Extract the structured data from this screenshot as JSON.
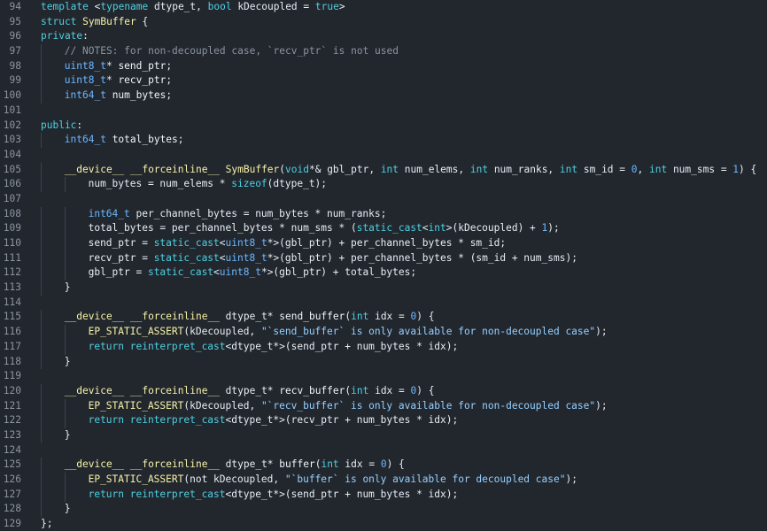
{
  "editor": {
    "colors": {
      "background": "#22272e",
      "line_number": "#8b949e",
      "keyword": "#4dd0e1",
      "type": "#6cb6ff",
      "string": "#96d0ff",
      "comment": "#8b949e",
      "text": "#e6edf3"
    },
    "lines": [
      {
        "n": "94",
        "indent": 0,
        "segments": [
          [
            "kw",
            "template "
          ],
          [
            "tx",
            "<"
          ],
          [
            "kw",
            "typename "
          ],
          [
            "tx",
            "dtype_t, "
          ],
          [
            "kw",
            "bool "
          ],
          [
            "tx",
            "kDecoupled = "
          ],
          [
            "kw",
            "true"
          ],
          [
            "tx",
            ">"
          ]
        ]
      },
      {
        "n": "95",
        "indent": 0,
        "segments": [
          [
            "kw",
            "struct "
          ],
          [
            "ex",
            "SymBuffer"
          ],
          [
            "tx",
            " {"
          ]
        ]
      },
      {
        "n": "96",
        "indent": 0,
        "segments": [
          [
            "kw",
            "private"
          ],
          [
            "tx",
            ":"
          ]
        ]
      },
      {
        "n": "97",
        "indent": 1,
        "segments": [
          [
            "cm",
            "// NOTES: for non-decoupled case, `recv_ptr` is not used"
          ]
        ]
      },
      {
        "n": "98",
        "indent": 1,
        "segments": [
          [
            "ty",
            "uint8_t"
          ],
          [
            "tx",
            "* "
          ],
          [
            "fn",
            "send_ptr"
          ],
          [
            "tx",
            ";"
          ]
        ]
      },
      {
        "n": "99",
        "indent": 1,
        "segments": [
          [
            "ty",
            "uint8_t"
          ],
          [
            "tx",
            "* "
          ],
          [
            "fn",
            "recv_ptr"
          ],
          [
            "tx",
            ";"
          ]
        ]
      },
      {
        "n": "100",
        "indent": 1,
        "segments": [
          [
            "ty",
            "int64_t "
          ],
          [
            "fn",
            "num_bytes"
          ],
          [
            "tx",
            ";"
          ]
        ]
      },
      {
        "n": "101",
        "indent": 0,
        "segments": []
      },
      {
        "n": "102",
        "indent": 0,
        "segments": [
          [
            "kw",
            "public"
          ],
          [
            "tx",
            ":"
          ]
        ]
      },
      {
        "n": "103",
        "indent": 1,
        "segments": [
          [
            "ty",
            "int64_t "
          ],
          [
            "fn",
            "total_bytes"
          ],
          [
            "tx",
            ";"
          ]
        ]
      },
      {
        "n": "104",
        "indent": 0,
        "segments": []
      },
      {
        "n": "105",
        "indent": 1,
        "segments": [
          [
            "ex",
            "__device__ __forceinline__ SymBuffer"
          ],
          [
            "tx",
            "("
          ],
          [
            "kw",
            "void"
          ],
          [
            "tx",
            "*& gbl_ptr, "
          ],
          [
            "kw",
            "int "
          ],
          [
            "tx",
            "num_elems, "
          ],
          [
            "kw",
            "int "
          ],
          [
            "tx",
            "num_ranks, "
          ],
          [
            "kw",
            "int "
          ],
          [
            "tx",
            "sm_id = "
          ],
          [
            "num",
            "0"
          ],
          [
            "tx",
            ", "
          ],
          [
            "kw",
            "int "
          ],
          [
            "tx",
            "num_sms = "
          ],
          [
            "num",
            "1"
          ],
          [
            "tx",
            ") {"
          ]
        ]
      },
      {
        "n": "106",
        "indent": 2,
        "segments": [
          [
            "tx",
            "num_bytes = num_elems * "
          ],
          [
            "kw",
            "sizeof"
          ],
          [
            "tx",
            "(dtype_t);"
          ]
        ]
      },
      {
        "n": "107",
        "indent": 0,
        "segments": []
      },
      {
        "n": "108",
        "indent": 2,
        "segments": [
          [
            "ty",
            "int64_t "
          ],
          [
            "tx",
            "per_channel_bytes = num_bytes * num_ranks;"
          ]
        ]
      },
      {
        "n": "109",
        "indent": 2,
        "segments": [
          [
            "tx",
            "total_bytes = per_channel_bytes * num_sms * ("
          ],
          [
            "kw",
            "static_cast"
          ],
          [
            "tx",
            "<"
          ],
          [
            "kw",
            "int"
          ],
          [
            "tx",
            ">(kDecoupled) + "
          ],
          [
            "num",
            "1"
          ],
          [
            "tx",
            ");"
          ]
        ]
      },
      {
        "n": "110",
        "indent": 2,
        "segments": [
          [
            "tx",
            "send_ptr = "
          ],
          [
            "kw",
            "static_cast"
          ],
          [
            "tx",
            "<"
          ],
          [
            "ty",
            "uint8_t"
          ],
          [
            "tx",
            "*>(gbl_ptr) + per_channel_bytes * sm_id;"
          ]
        ]
      },
      {
        "n": "111",
        "indent": 2,
        "segments": [
          [
            "tx",
            "recv_ptr = "
          ],
          [
            "kw",
            "static_cast"
          ],
          [
            "tx",
            "<"
          ],
          [
            "ty",
            "uint8_t"
          ],
          [
            "tx",
            "*>(gbl_ptr) + per_channel_bytes * (sm_id + num_sms);"
          ]
        ]
      },
      {
        "n": "112",
        "indent": 2,
        "segments": [
          [
            "tx",
            "gbl_ptr = "
          ],
          [
            "kw",
            "static_cast"
          ],
          [
            "tx",
            "<"
          ],
          [
            "ty",
            "uint8_t"
          ],
          [
            "tx",
            "*>(gbl_ptr) + total_bytes;"
          ]
        ]
      },
      {
        "n": "113",
        "indent": 1,
        "segments": [
          [
            "tx",
            "}"
          ]
        ]
      },
      {
        "n": "114",
        "indent": 0,
        "segments": []
      },
      {
        "n": "115",
        "indent": 1,
        "segments": [
          [
            "ex",
            "__device__ __forceinline__ "
          ],
          [
            "tx",
            "dtype_t* "
          ],
          [
            "fn",
            "send_buffer"
          ],
          [
            "tx",
            "("
          ],
          [
            "kw",
            "int "
          ],
          [
            "tx",
            "idx = "
          ],
          [
            "num",
            "0"
          ],
          [
            "tx",
            ") {"
          ]
        ]
      },
      {
        "n": "116",
        "indent": 2,
        "segments": [
          [
            "ex",
            "EP_STATIC_ASSERT"
          ],
          [
            "tx",
            "(kDecoupled, "
          ],
          [
            "str",
            "\"`send_buffer` is only available for non-decoupled case\""
          ],
          [
            "tx",
            ");"
          ]
        ]
      },
      {
        "n": "117",
        "indent": 2,
        "segments": [
          [
            "kw",
            "return "
          ],
          [
            "kw",
            "reinterpret_cast"
          ],
          [
            "tx",
            "<dtype_t*>(send_ptr + num_bytes * idx);"
          ]
        ]
      },
      {
        "n": "118",
        "indent": 1,
        "segments": [
          [
            "tx",
            "}"
          ]
        ]
      },
      {
        "n": "119",
        "indent": 0,
        "segments": []
      },
      {
        "n": "120",
        "indent": 1,
        "segments": [
          [
            "ex",
            "__device__ __forceinline__ "
          ],
          [
            "tx",
            "dtype_t* "
          ],
          [
            "fn",
            "recv_buffer"
          ],
          [
            "tx",
            "("
          ],
          [
            "kw",
            "int "
          ],
          [
            "tx",
            "idx = "
          ],
          [
            "num",
            "0"
          ],
          [
            "tx",
            ") {"
          ]
        ]
      },
      {
        "n": "121",
        "indent": 2,
        "segments": [
          [
            "ex",
            "EP_STATIC_ASSERT"
          ],
          [
            "tx",
            "(kDecoupled, "
          ],
          [
            "str",
            "\"`recv_buffer` is only available for non-decoupled case\""
          ],
          [
            "tx",
            ");"
          ]
        ]
      },
      {
        "n": "122",
        "indent": 2,
        "segments": [
          [
            "kw",
            "return "
          ],
          [
            "kw",
            "reinterpret_cast"
          ],
          [
            "tx",
            "<dtype_t*>(recv_ptr + num_bytes * idx);"
          ]
        ]
      },
      {
        "n": "123",
        "indent": 1,
        "segments": [
          [
            "tx",
            "}"
          ]
        ]
      },
      {
        "n": "124",
        "indent": 0,
        "segments": []
      },
      {
        "n": "125",
        "indent": 1,
        "segments": [
          [
            "ex",
            "__device__ __forceinline__ "
          ],
          [
            "tx",
            "dtype_t* "
          ],
          [
            "fn",
            "buffer"
          ],
          [
            "tx",
            "("
          ],
          [
            "kw",
            "int "
          ],
          [
            "tx",
            "idx = "
          ],
          [
            "num",
            "0"
          ],
          [
            "tx",
            ") {"
          ]
        ]
      },
      {
        "n": "126",
        "indent": 2,
        "segments": [
          [
            "ex",
            "EP_STATIC_ASSERT"
          ],
          [
            "tx",
            "(not kDecoupled, "
          ],
          [
            "str",
            "\"`buffer` is only available for decoupled case\""
          ],
          [
            "tx",
            ");"
          ]
        ]
      },
      {
        "n": "127",
        "indent": 2,
        "segments": [
          [
            "kw",
            "return "
          ],
          [
            "kw",
            "reinterpret_cast"
          ],
          [
            "tx",
            "<dtype_t*>(send_ptr + num_bytes * idx);"
          ]
        ]
      },
      {
        "n": "128",
        "indent": 1,
        "segments": [
          [
            "tx",
            "}"
          ]
        ]
      },
      {
        "n": "129",
        "indent": 0,
        "segments": [
          [
            "tx",
            "};"
          ]
        ]
      }
    ]
  }
}
